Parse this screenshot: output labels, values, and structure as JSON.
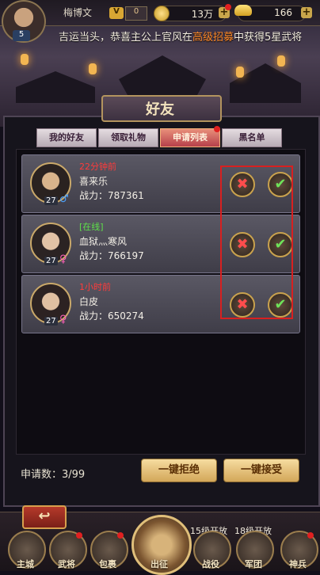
{
  "player": {
    "name": "梅博文",
    "level": "5",
    "vip_label": "V",
    "vip_value": "0"
  },
  "resources": {
    "coins": "13万",
    "ingots": "166"
  },
  "marquee": {
    "prefix": "吉运当头，恭喜主公上官风在",
    "highlight": "高级招募",
    "suffix": "中获得5星武将"
  },
  "panel": {
    "title": "好友"
  },
  "tabs": [
    {
      "label": "我的好友",
      "active": false
    },
    {
      "label": "领取礼物",
      "active": false
    },
    {
      "label": "申请列表",
      "active": true
    },
    {
      "label": "黑名单",
      "active": false
    }
  ],
  "requests": [
    {
      "status": "22分钟前",
      "status_color": "#ff3b3b",
      "name": "喜来乐",
      "power": "战力：787361",
      "level": "27",
      "gender_icon": "♂",
      "gender_color": "#4aa3ff"
    },
    {
      "status": "[在线]",
      "status_color": "#5ee04a",
      "name": "血狱灬寒风",
      "power": "战力：766197",
      "level": "27",
      "gender_icon": "♀",
      "gender_color": "#ff5fb8"
    },
    {
      "status": "1小时前",
      "status_color": "#ff3b3b",
      "name": "白皮",
      "power": "战力：650274",
      "level": "27",
      "gender_icon": "♀",
      "gender_color": "#ff5fb8"
    }
  ],
  "footer": {
    "count_label": "申请数：3/99",
    "reject_all": "一键拒绝",
    "accept_all": "一键接受"
  },
  "nav": {
    "main_city": "主城",
    "generals": "武将",
    "bag": "包裹",
    "campaign": "出征",
    "battle": "战役",
    "legion": "军团",
    "divine_weapon": "神兵",
    "battle_unlock": "15级开放",
    "legion_unlock": "18级开放"
  },
  "icons": {
    "accept": "✔",
    "reject": "✖",
    "back": "↩"
  }
}
